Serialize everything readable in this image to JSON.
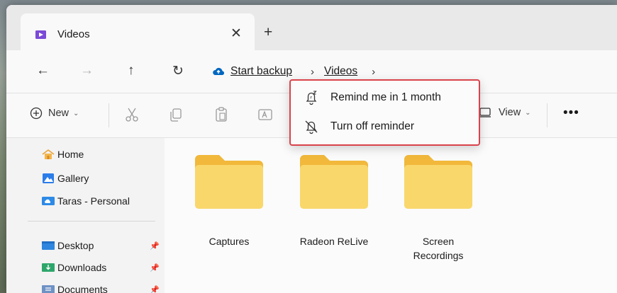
{
  "tab": {
    "title": "Videos",
    "close_glyph": "✕",
    "new_tab_glyph": "+"
  },
  "nav": {
    "back_glyph": "←",
    "forward_glyph": "→",
    "up_glyph": "↑",
    "refresh_glyph": "↻",
    "breadcrumbs": [
      "Start backup",
      "Videos"
    ],
    "separator": "›"
  },
  "commands": {
    "new_label": "New",
    "view_label": "View",
    "chevron": "⌄",
    "more_glyph": "•••"
  },
  "context_menu": {
    "items": [
      {
        "label": "Remind me in 1 month",
        "icon": "snooze-bell-icon"
      },
      {
        "label": "Turn off reminder",
        "icon": "bell-off-icon"
      }
    ]
  },
  "sidebar": {
    "items": [
      {
        "label": "Home",
        "icon": "home-icon"
      },
      {
        "label": "Gallery",
        "icon": "gallery-icon"
      },
      {
        "label": "Taras - Personal",
        "icon": "onedrive-folder-icon"
      }
    ],
    "pinned": [
      {
        "label": "Desktop",
        "icon": "desktop-folder-icon"
      },
      {
        "label": "Downloads",
        "icon": "downloads-folder-icon"
      },
      {
        "label": "Documents",
        "icon": "documents-folder-icon"
      }
    ],
    "pin_glyph": "📌"
  },
  "folders": [
    {
      "label": "Captures"
    },
    {
      "label": "Radeon ReLive"
    },
    {
      "label": "Screen Recordings"
    }
  ],
  "colors": {
    "accent_blue": "#0067c0",
    "folder_yellow": "#f9d76b",
    "folder_tab": "#f1b83b",
    "menu_highlight_border": "#d9434b"
  }
}
